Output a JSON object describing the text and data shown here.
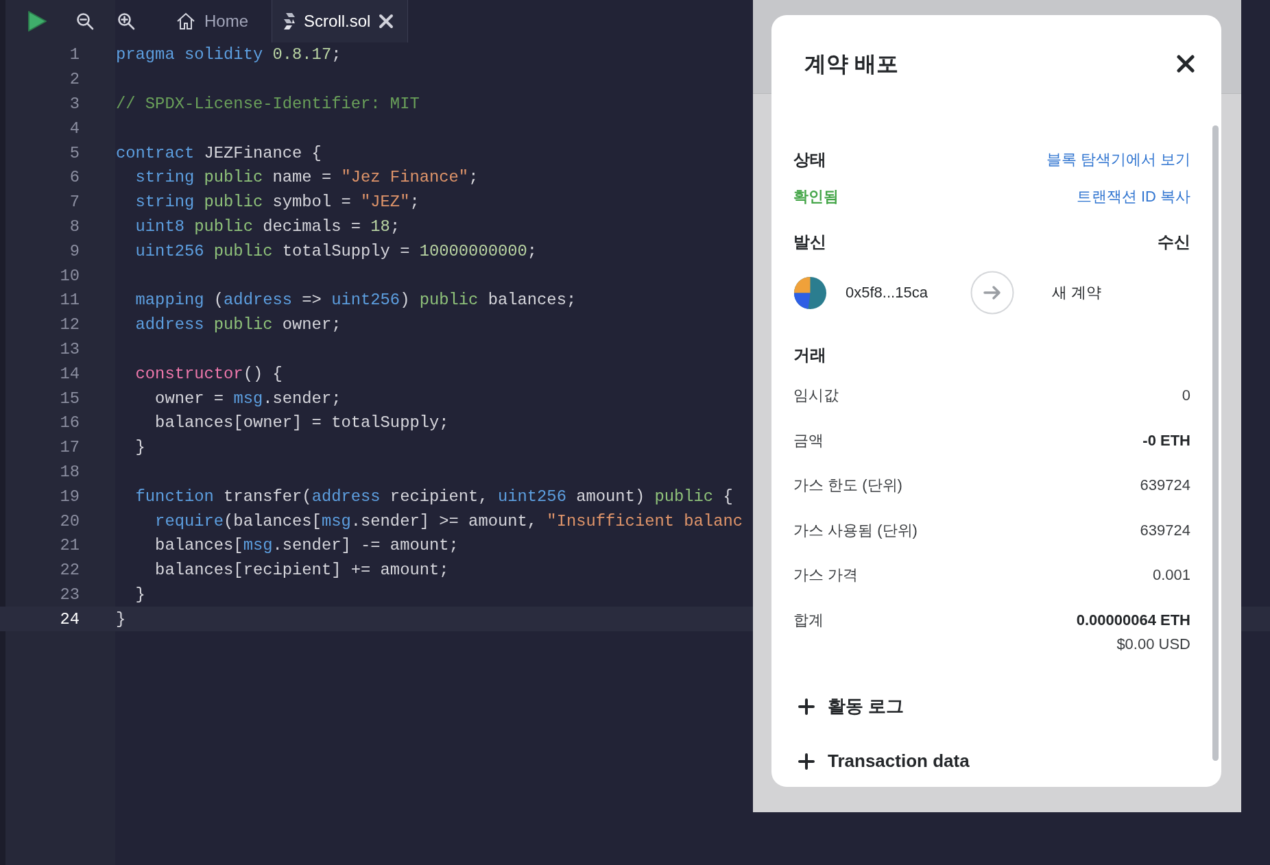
{
  "toolbar": {
    "tabs": [
      {
        "label": "Home",
        "kind": "home",
        "selected": false
      },
      {
        "label": "Scroll.sol",
        "kind": "file",
        "selected": true
      }
    ]
  },
  "editor": {
    "lines": [
      {
        "number": "1",
        "selected": false,
        "tokens": [
          {
            "text": "pragma solidity",
            "kind": "keyword"
          },
          {
            "text": " 0.8.17",
            "kind": "number"
          },
          {
            "text": ";",
            "kind": "plain"
          }
        ]
      },
      {
        "number": "2",
        "selected": false
      },
      {
        "number": "3",
        "selected": false,
        "tokens": [
          {
            "text": "// SPDX-License-Identifier: MIT",
            "kind": "comment"
          }
        ]
      },
      {
        "number": "4",
        "selected": false
      },
      {
        "number": "5",
        "selected": false,
        "tokens": [
          {
            "text": "contract",
            "kind": "keyword"
          },
          {
            "text": " JEZFinance {",
            "kind": "plain"
          }
        ]
      },
      {
        "number": "6",
        "selected": false,
        "tokens": [
          {
            "text": "  string",
            "kind": "keyword"
          },
          {
            "text": " public",
            "kind": "modifier"
          },
          {
            "text": " name = ",
            "kind": "plain"
          },
          {
            "text": "\"Jez Finance\"",
            "kind": "string"
          },
          {
            "text": ";",
            "kind": "plain"
          }
        ]
      },
      {
        "number": "7",
        "selected": false,
        "tokens": [
          {
            "text": "  string",
            "kind": "keyword"
          },
          {
            "text": " public",
            "kind": "modifier"
          },
          {
            "text": " symbol = ",
            "kind": "plain"
          },
          {
            "text": "\"JEZ\"",
            "kind": "string"
          },
          {
            "text": ";",
            "kind": "plain"
          }
        ]
      },
      {
        "number": "8",
        "selected": false,
        "tokens": [
          {
            "text": "  uint8",
            "kind": "keyword"
          },
          {
            "text": " public",
            "kind": "modifier"
          },
          {
            "text": " decimals = ",
            "kind": "plain"
          },
          {
            "text": "18",
            "kind": "number"
          },
          {
            "text": ";",
            "kind": "plain"
          }
        ]
      },
      {
        "number": "9",
        "selected": false,
        "tokens": [
          {
            "text": "  uint256",
            "kind": "keyword"
          },
          {
            "text": " public",
            "kind": "modifier"
          },
          {
            "text": " totalSupply = ",
            "kind": "plain"
          },
          {
            "text": "10000000000",
            "kind": "number"
          },
          {
            "text": ";",
            "kind": "plain"
          }
        ]
      },
      {
        "number": "10",
        "selected": false
      },
      {
        "number": "11",
        "selected": false,
        "tokens": [
          {
            "text": "  mapping",
            "kind": "keyword"
          },
          {
            "text": " (",
            "kind": "plain"
          },
          {
            "text": "address",
            "kind": "keyword"
          },
          {
            "text": " => ",
            "kind": "plain"
          },
          {
            "text": "uint256",
            "kind": "keyword"
          },
          {
            "text": ") ",
            "kind": "plain"
          },
          {
            "text": "public",
            "kind": "modifier"
          },
          {
            "text": " balances;",
            "kind": "plain"
          }
        ]
      },
      {
        "number": "12",
        "selected": false,
        "tokens": [
          {
            "text": "  address",
            "kind": "keyword"
          },
          {
            "text": " public",
            "kind": "modifier"
          },
          {
            "text": " owner;",
            "kind": "plain"
          }
        ]
      },
      {
        "number": "13",
        "selected": false
      },
      {
        "number": "14",
        "selected": false,
        "tokens": [
          {
            "text": "  constructor",
            "kind": "special"
          },
          {
            "text": "() {",
            "kind": "plain"
          }
        ]
      },
      {
        "number": "15",
        "selected": false,
        "tokens": [
          {
            "text": "    owner = ",
            "kind": "plain"
          },
          {
            "text": "msg",
            "kind": "keyword"
          },
          {
            "text": ".sender;",
            "kind": "plain"
          }
        ]
      },
      {
        "number": "16",
        "selected": false,
        "tokens": [
          {
            "text": "    balances[owner] = totalSupply;",
            "kind": "plain"
          }
        ]
      },
      {
        "number": "17",
        "selected": false,
        "tokens": [
          {
            "text": "  }",
            "kind": "plain"
          }
        ]
      },
      {
        "number": "18",
        "selected": false
      },
      {
        "number": "19",
        "selected": false,
        "tokens": [
          {
            "text": "  function",
            "kind": "keyword"
          },
          {
            "text": " transfer(",
            "kind": "plain"
          },
          {
            "text": "address",
            "kind": "keyword"
          },
          {
            "text": " recipient, ",
            "kind": "plain"
          },
          {
            "text": "uint256",
            "kind": "keyword"
          },
          {
            "text": " amount) ",
            "kind": "plain"
          },
          {
            "text": "public",
            "kind": "modifier"
          },
          {
            "text": " {",
            "kind": "plain"
          }
        ]
      },
      {
        "number": "20",
        "selected": false,
        "tokens": [
          {
            "text": "    require",
            "kind": "keyword"
          },
          {
            "text": "(balances[",
            "kind": "plain"
          },
          {
            "text": "msg",
            "kind": "keyword"
          },
          {
            "text": ".sender] >= amount, ",
            "kind": "plain"
          },
          {
            "text": "\"Insufficient balanc",
            "kind": "string"
          }
        ]
      },
      {
        "number": "21",
        "selected": false,
        "tokens": [
          {
            "text": "    balances[",
            "kind": "plain"
          },
          {
            "text": "msg",
            "kind": "keyword"
          },
          {
            "text": ".sender] -= amount;",
            "kind": "plain"
          }
        ]
      },
      {
        "number": "22",
        "selected": false,
        "tokens": [
          {
            "text": "    balances[recipient] += amount;",
            "kind": "plain"
          }
        ]
      },
      {
        "number": "23",
        "selected": false,
        "tokens": [
          {
            "text": "  }",
            "kind": "plain"
          }
        ]
      },
      {
        "number": "24",
        "selected": true,
        "tokens": [
          {
            "text": "}",
            "kind": "plain"
          }
        ]
      }
    ]
  },
  "dialog": {
    "title": "계약 배포",
    "status": {
      "heading": "상태",
      "explorer_link": "블록 탐색기에서 보기",
      "value": "확인됨",
      "copy_link": "트랜잭션 ID 복사"
    },
    "parties": {
      "from_heading": "발신",
      "to_heading": "수신",
      "from_address": "0x5f8...15ca",
      "to": "새 계약"
    },
    "transaction": {
      "heading": "거래",
      "rows": [
        {
          "label": "임시값",
          "value": "0",
          "bold": false
        },
        {
          "label": "금액",
          "value": "-0 ETH",
          "bold": true
        },
        {
          "label": "가스 한도 (단위)",
          "value": "639724",
          "bold": false
        },
        {
          "label": "가스 사용됨 (단위)",
          "value": "639724",
          "bold": false
        },
        {
          "label": "가스 가격",
          "value": "0.001",
          "bold": false
        },
        {
          "label": "합계",
          "value": "0.00000064 ETH",
          "bold": true,
          "sub": "$0.00 USD"
        }
      ]
    },
    "sections": [
      {
        "label": "활동 로그",
        "expanded": false
      },
      {
        "label": "Transaction data",
        "expanded": false
      }
    ]
  }
}
